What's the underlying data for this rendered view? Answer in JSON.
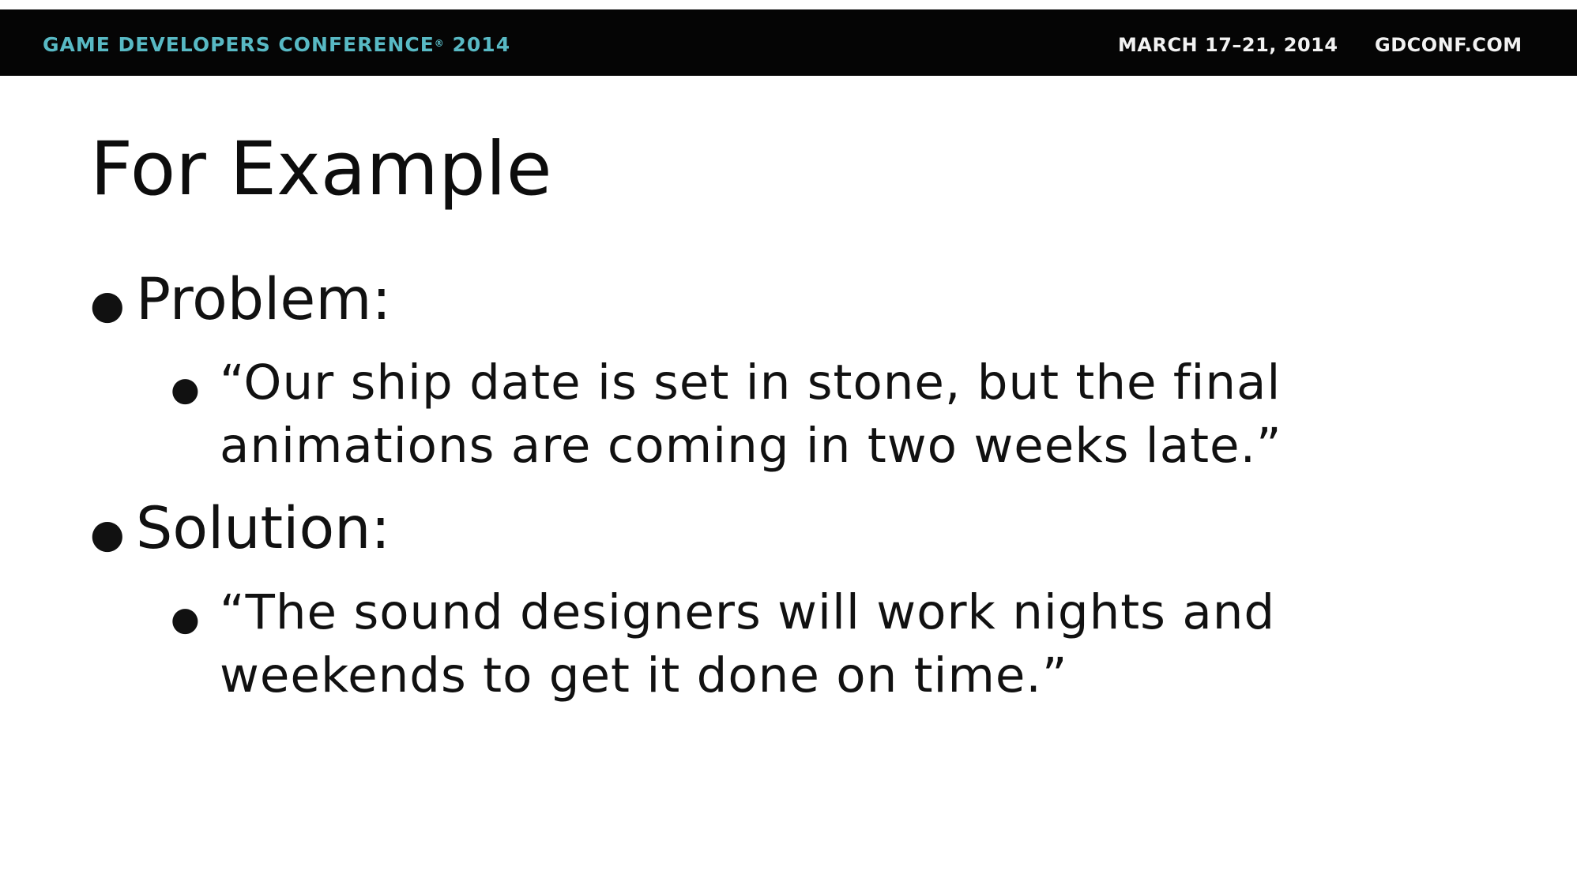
{
  "header": {
    "conference": "GAME DEVELOPERS CONFERENCE",
    "conference_mark": "®",
    "year": "2014",
    "dates": "MARCH 17–21, 2014",
    "website": "GDCONF.COM",
    "bar_color": "#050505",
    "accent_color": "#58b9c4"
  },
  "slide": {
    "title": "For Example",
    "bullets": [
      {
        "label": "Problem:",
        "sub": {
          "line1": "“Our ship date is set in stone, but the final",
          "line2": "animations are coming in two weeks late.”"
        }
      },
      {
        "label": "Solution:",
        "sub": {
          "line1": "“The sound designers will work nights and",
          "line2": "weekends to get it done on time.”"
        }
      }
    ]
  }
}
